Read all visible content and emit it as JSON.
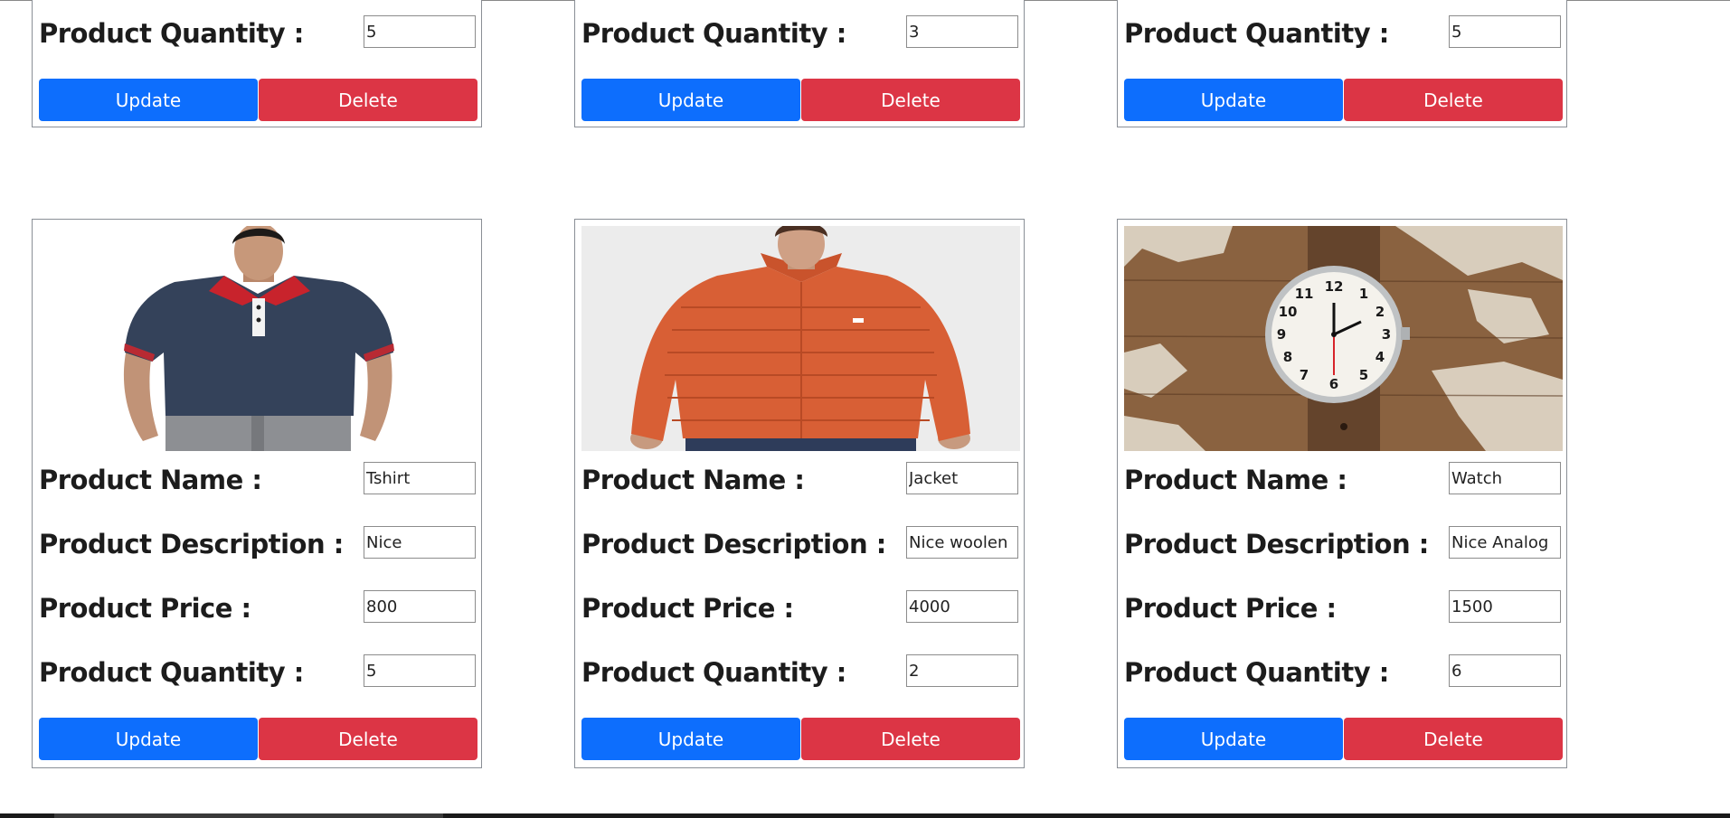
{
  "labels": {
    "name": "Product Name :",
    "description": "Product Description :",
    "price": "Product Price :",
    "quantity": "Product Quantity :",
    "update": "Update",
    "delete": "Delete"
  },
  "top_row": [
    {
      "quantity": "5"
    },
    {
      "quantity": "3"
    },
    {
      "quantity": "5"
    }
  ],
  "products": [
    {
      "image": "navy polo t-shirt photo",
      "name": "Tshirt",
      "description": "Nice",
      "price": "800",
      "quantity": "5"
    },
    {
      "image": "orange puffer jacket photo",
      "name": "Jacket",
      "description": "Nice woolen",
      "price": "4000",
      "quantity": "2"
    },
    {
      "image": "analog wrist watch photo",
      "name": "Watch",
      "description": "Nice Analog",
      "price": "1500",
      "quantity": "6"
    }
  ],
  "colors": {
    "update": "#0d6efd",
    "delete": "#dc3545"
  }
}
